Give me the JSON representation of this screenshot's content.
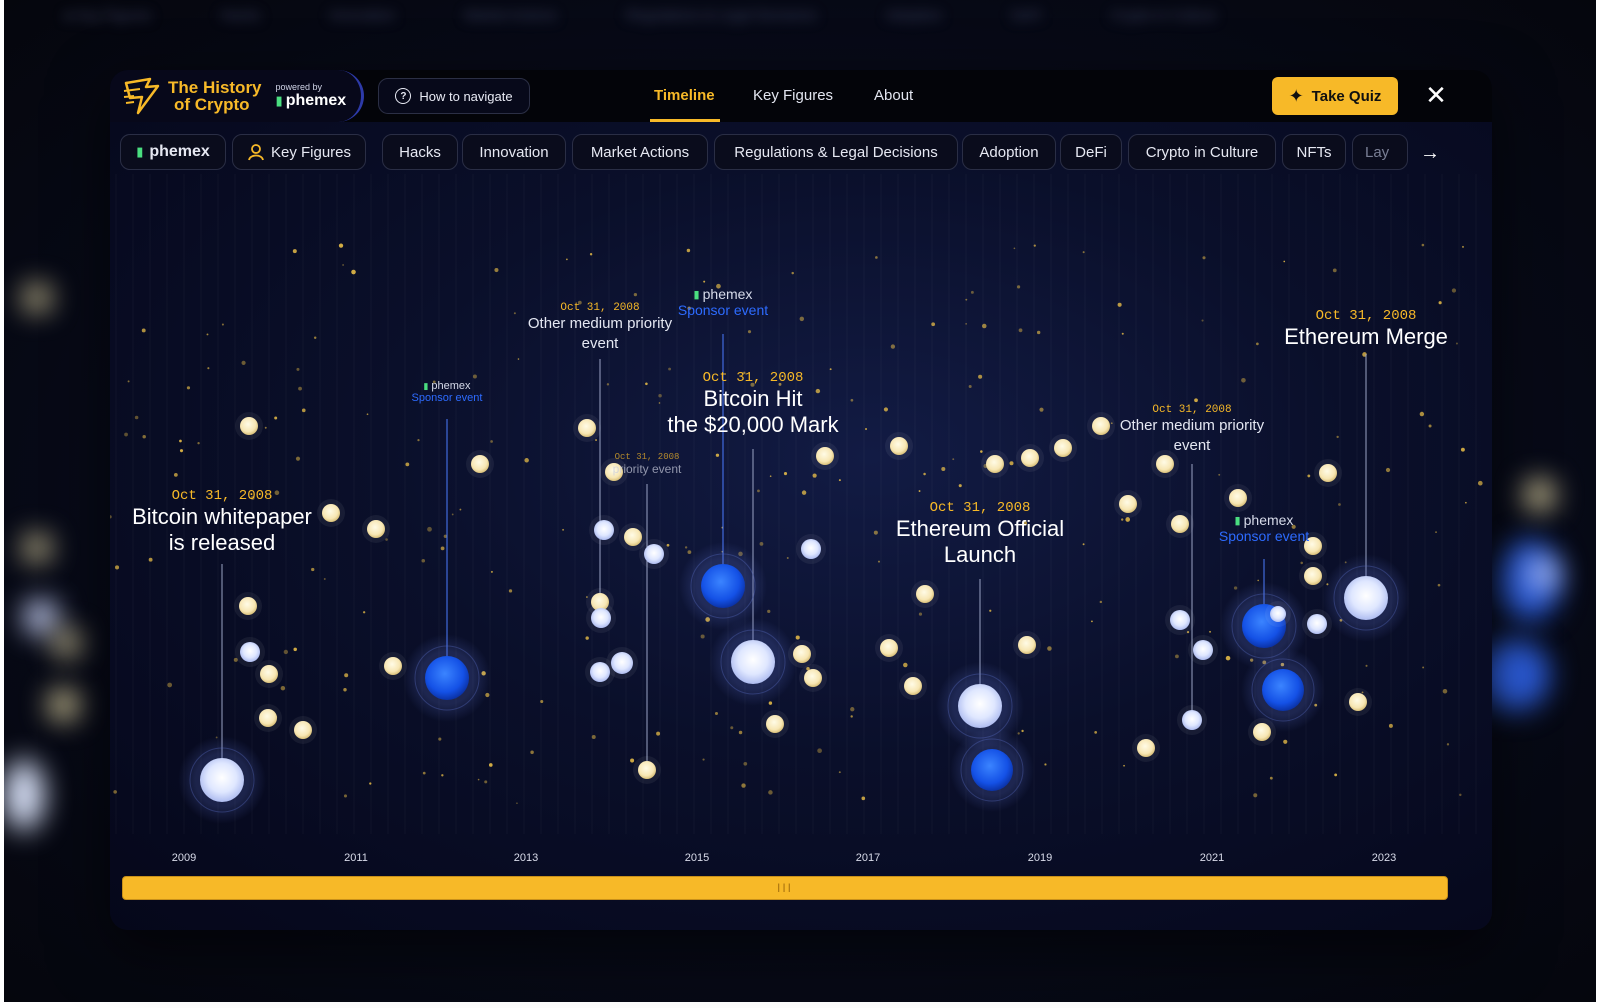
{
  "header": {
    "brand_title_line1": "The History",
    "brand_title_line2": "of Crypto",
    "powered_by": "powered by",
    "partner": "phemex",
    "help_label": "How to navigate",
    "tabs": [
      {
        "label": "Timeline",
        "active": true
      },
      {
        "label": "Key Figures",
        "active": false
      },
      {
        "label": "About",
        "active": false
      }
    ],
    "quiz_label": "Take Quiz",
    "close_icon": "close-icon"
  },
  "filters": {
    "partner": "phemex",
    "key_figures": "Key Figures",
    "categories": [
      "Hacks",
      "Innovation",
      "Market Actions",
      "Regulations & Legal Decisions",
      "Adoption",
      "DeFi",
      "Crypto in Culture",
      "NFTs",
      "Lay"
    ],
    "next_icon": "arrow-right-icon"
  },
  "events": [
    {
      "date": "Oct 31, 2008",
      "title_line1": "Bitcoin whitepaper",
      "title_line2": "is released"
    },
    {
      "date": "Oct 31, 2008",
      "title_line1": "Other medium priority",
      "title_line2": "event"
    },
    {
      "date": "Oct 31, 2008",
      "title_line1": "Bitcoin Hit",
      "title_line2": "the $20,000 Mark"
    },
    {
      "date": "Oct 31, 2008",
      "title_line1": "priority event",
      "title_line2": ""
    },
    {
      "date": "Oct 31, 2008",
      "title_line1": "Ethereum Official",
      "title_line2": "Launch"
    },
    {
      "date": "Oct 31, 2008",
      "title_line1": "Other medium priority",
      "title_line2": "event"
    },
    {
      "date": "Oct 31, 2008",
      "title_line1": "Ethereum Merge",
      "title_line2": ""
    }
  ],
  "sponsors": [
    {
      "brand": "phemex",
      "label": "Sponsor event"
    },
    {
      "brand": "phemex",
      "label": "Sponsor event"
    },
    {
      "brand": "phemex",
      "label": "Sponsor event"
    }
  ],
  "timeline": {
    "years": [
      "2009",
      "2011",
      "2013",
      "2015",
      "2017",
      "2019",
      "2021",
      "2023"
    ],
    "scrubber_handle": "III"
  },
  "colors": {
    "accent": "#f7b928",
    "sponsor_blue": "#2d6bff",
    "node_white": "#dfe8ff",
    "node_gold": "#fbefc4"
  }
}
